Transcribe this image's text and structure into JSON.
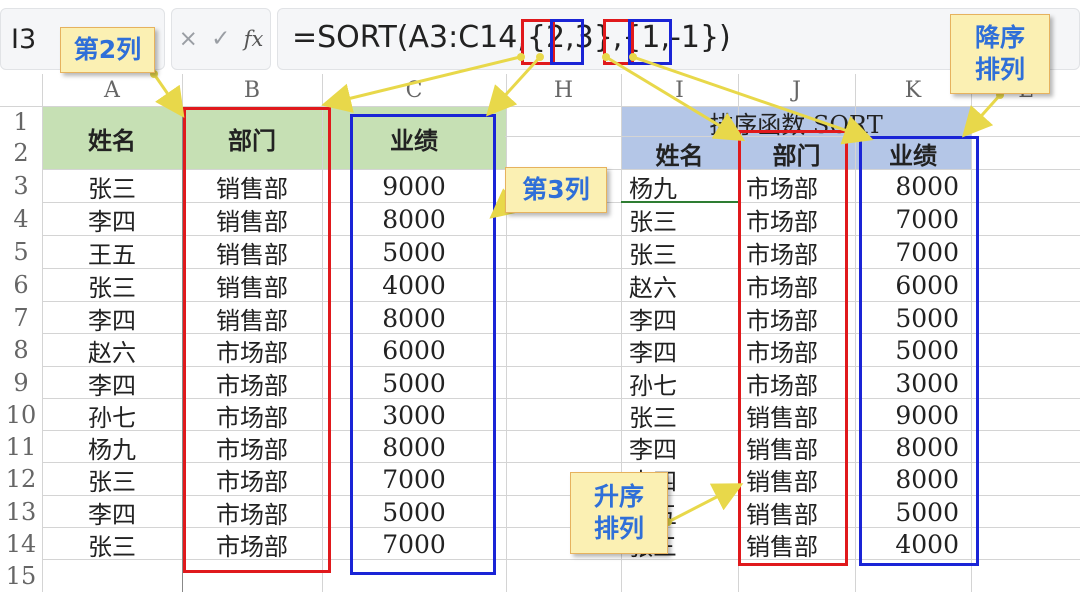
{
  "formula_bar": {
    "name_box": "I3",
    "cancel_icon": "×",
    "confirm_icon": "✓",
    "fx_label": "fx",
    "formula_parts": [
      "=SORT(A3:C14,{",
      "2",
      ",",
      "3",
      "},{",
      "1",
      ",",
      "-1",
      "})"
    ]
  },
  "columns": [
    "A",
    "B",
    "C",
    "H",
    "I",
    "J",
    "K",
    "L"
  ],
  "rows": [
    "1",
    "2",
    "3",
    "4",
    "5",
    "6",
    "7",
    "8",
    "9",
    "10",
    "11",
    "12",
    "13",
    "14",
    "15"
  ],
  "left_table": {
    "headers": [
      "姓名",
      "部门",
      "业绩"
    ],
    "rows": [
      [
        "张三",
        "销售部",
        "9000"
      ],
      [
        "李四",
        "销售部",
        "8000"
      ],
      [
        "王五",
        "销售部",
        "5000"
      ],
      [
        "张三",
        "销售部",
        "4000"
      ],
      [
        "李四",
        "销售部",
        "8000"
      ],
      [
        "赵六",
        "市场部",
        "6000"
      ],
      [
        "李四",
        "市场部",
        "5000"
      ],
      [
        "孙七",
        "市场部",
        "3000"
      ],
      [
        "杨九",
        "市场部",
        "8000"
      ],
      [
        "张三",
        "市场部",
        "7000"
      ],
      [
        "李四",
        "市场部",
        "5000"
      ],
      [
        "张三",
        "市场部",
        "7000"
      ]
    ]
  },
  "right_table": {
    "title": "排序函数 SORT",
    "headers": [
      "姓名",
      "部门",
      "业绩"
    ],
    "rows": [
      [
        "杨九",
        "市场部",
        "8000"
      ],
      [
        "张三",
        "市场部",
        "7000"
      ],
      [
        "张三",
        "市场部",
        "7000"
      ],
      [
        "赵六",
        "市场部",
        "6000"
      ],
      [
        "李四",
        "市场部",
        "5000"
      ],
      [
        "李四",
        "市场部",
        "5000"
      ],
      [
        "孙七",
        "市场部",
        "3000"
      ],
      [
        "张三",
        "销售部",
        "9000"
      ],
      [
        "李四",
        "销售部",
        "8000"
      ],
      [
        "李四",
        "销售部",
        "8000"
      ],
      [
        "王五",
        "销售部",
        "5000"
      ],
      [
        "张三",
        "销售部",
        "4000"
      ]
    ]
  },
  "callouts": {
    "col2": "第2列",
    "col3": "第3列",
    "descending": [
      "降序",
      "排列"
    ],
    "ascending": [
      "升序",
      "排列"
    ]
  },
  "colors": {
    "header_green": "#c6e0b4",
    "header_blue": "#b4c6e7",
    "callout_fill": "#fbf0b3",
    "callout_text": "#2f6fd8",
    "highlight_red": "#e0191c",
    "highlight_blue": "#1a24d6",
    "arrow": "#e8d84a"
  }
}
